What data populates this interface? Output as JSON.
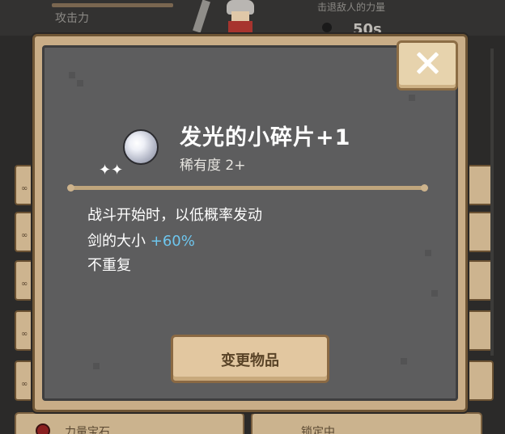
{
  "hud": {
    "attack_label": "攻击力",
    "enemy_label": "击退敌人的力量",
    "timer": "50s"
  },
  "dialog": {
    "item": {
      "name": "发光的小碎片+1",
      "rarity": "稀有度 2+",
      "icon": "glowing-shard-orb-icon",
      "sparkle_icon": "✦✦"
    },
    "description": {
      "line1": "战斗开始时，以低概率发动",
      "line2_prefix": "剑的大小 ",
      "line2_value": "+60%",
      "line3": "不重复"
    },
    "change_button_label": "变更物品",
    "close_icon": "close-x-icon"
  },
  "bottom": {
    "left_button_label": "力量宝石",
    "right_button_label": "锁定中"
  },
  "colors": {
    "highlight": "#6ec6ee",
    "panel": "#5d5d5e",
    "frame": "#c9ad87",
    "button": "#e2c7a0"
  }
}
